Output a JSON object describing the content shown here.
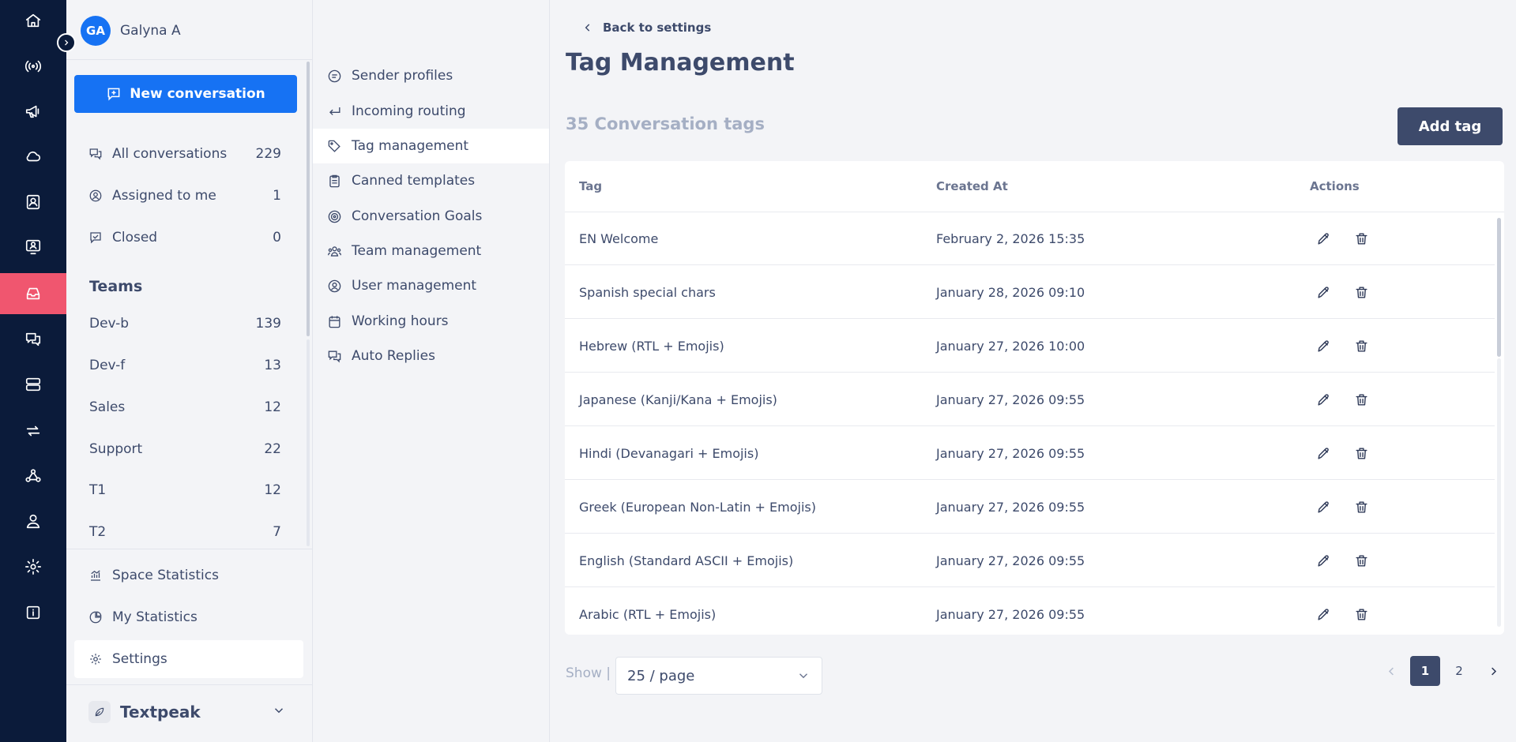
{
  "rail": {
    "items": [
      {
        "icon": "home-icon"
      },
      {
        "icon": "broadcast-icon"
      },
      {
        "icon": "megaphone-icon"
      },
      {
        "icon": "cloud-icon"
      },
      {
        "icon": "contact-card-icon"
      },
      {
        "icon": "support-agent-icon"
      },
      {
        "icon": "inbox-icon",
        "active": true
      },
      {
        "icon": "chat-bubbles-icon"
      },
      {
        "icon": "server-icon"
      },
      {
        "icon": "sync-arrows-icon"
      },
      {
        "icon": "webhook-icon"
      },
      {
        "icon": "user-icon"
      },
      {
        "icon": "gear-icon"
      },
      {
        "icon": "info-icon"
      }
    ],
    "active_color": "#f0566f",
    "background": "#0b1b3a"
  },
  "user": {
    "initials": "GA",
    "name": "Galyna A"
  },
  "sidebar": {
    "new_conversation": "New conversation",
    "conversations": [
      {
        "label": "All conversations",
        "count": "229"
      },
      {
        "label": "Assigned to me",
        "count": "1"
      },
      {
        "label": "Closed",
        "count": "0"
      }
    ],
    "teams_title": "Teams",
    "teams": [
      {
        "label": "Dev-b",
        "count": "139"
      },
      {
        "label": "Dev-f",
        "count": "13"
      },
      {
        "label": "Sales",
        "count": "12"
      },
      {
        "label": "Support",
        "count": "22"
      },
      {
        "label": "T1",
        "count": "12"
      },
      {
        "label": "T2",
        "count": "7"
      }
    ],
    "bottom": [
      {
        "label": "Space Statistics"
      },
      {
        "label": "My Statistics"
      },
      {
        "label": "Settings"
      }
    ],
    "brand": "Textpeak"
  },
  "settings_menu": {
    "items": [
      {
        "label": "Sender profiles"
      },
      {
        "label": "Incoming routing"
      },
      {
        "label": "Tag management",
        "active": true
      },
      {
        "label": "Canned templates"
      },
      {
        "label": "Conversation Goals"
      },
      {
        "label": "Team management"
      },
      {
        "label": "User management"
      },
      {
        "label": "Working hours"
      },
      {
        "label": "Auto Replies"
      }
    ]
  },
  "main": {
    "back_label": "Back to settings",
    "title": "Tag Management",
    "tag_count": "35 Conversation tags",
    "add_tag": "Add tag",
    "columns": {
      "tag": "Tag",
      "created": "Created At",
      "actions": "Actions"
    },
    "rows": [
      {
        "tag": "EN Welcome",
        "created": "February 2, 2026 15:35"
      },
      {
        "tag": "Spanish special chars",
        "created": "January 28, 2026 09:10"
      },
      {
        "tag": "Hebrew (RTL + Emojis)",
        "created": "January 27, 2026 10:00"
      },
      {
        "tag": "Japanese (Kanji/Kana + Emojis)",
        "created": "January 27, 2026 09:55"
      },
      {
        "tag": "Hindi (Devanagari + Emojis)",
        "created": "January 27, 2026 09:55"
      },
      {
        "tag": "Greek (European Non-Latin + Emojis)",
        "created": "January 27, 2026 09:55"
      },
      {
        "tag": "English (Standard ASCII + Emojis)",
        "created": "January 27, 2026 09:55"
      },
      {
        "tag": "Arabic (RTL + Emojis)",
        "created": "January 27, 2026 09:55"
      }
    ],
    "show_label": "Show |",
    "page_size": "25 / page",
    "pagination": {
      "pages": [
        "1",
        "2"
      ],
      "current": "1"
    }
  },
  "colors": {
    "primary": "#1672f3",
    "dark": "#3d4a6b",
    "muted": "#a5afc4"
  }
}
